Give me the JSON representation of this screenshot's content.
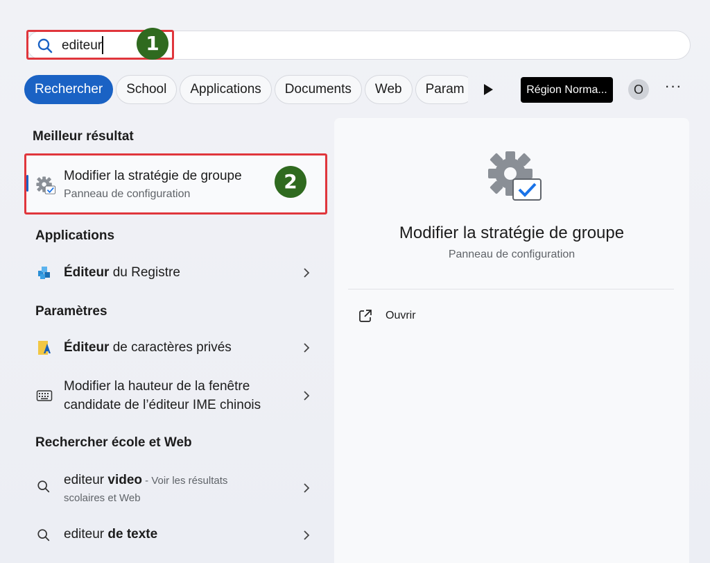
{
  "search": {
    "value": "editeur",
    "icon": "search-icon"
  },
  "annotations": {
    "step1": "1",
    "step2": "2",
    "color": "#e0363c",
    "badge_color": "#2f6a1f"
  },
  "filters": {
    "chips": [
      "Rechercher",
      "School",
      "Applications",
      "Documents",
      "Web",
      "Param"
    ],
    "active_index": 0,
    "region_label": "Région Norma...",
    "avatar_initial": "O",
    "more_label": "···"
  },
  "best_match": {
    "heading": "Meilleur résultat",
    "title": "Modifier la stratégie de groupe",
    "subtitle": "Panneau de configuration"
  },
  "applications": {
    "heading": "Applications",
    "items": [
      {
        "bold": "Éditeur",
        "rest": " du Registre"
      }
    ]
  },
  "settings": {
    "heading": "Paramètres",
    "items": [
      {
        "bold": "Éditeur",
        "rest": " de caractères privés"
      },
      {
        "line1": "Modifier la hauteur de la fenêtre",
        "line2": "candidate de l’éditeur IME chinois"
      }
    ]
  },
  "web": {
    "heading": "Rechercher école et Web",
    "items": [
      {
        "prefix": "editeur ",
        "bold": "video",
        "suffix": " - Voir les résultats",
        "line2": "scolaires et Web"
      },
      {
        "prefix": "editeur ",
        "bold": "de texte"
      }
    ]
  },
  "detail": {
    "title": "Modifier la stratégie de groupe",
    "subtitle": "Panneau de configuration",
    "open_label": "Ouvrir"
  },
  "colors": {
    "accent": "#1a62c4",
    "background": "#eef0f5"
  }
}
